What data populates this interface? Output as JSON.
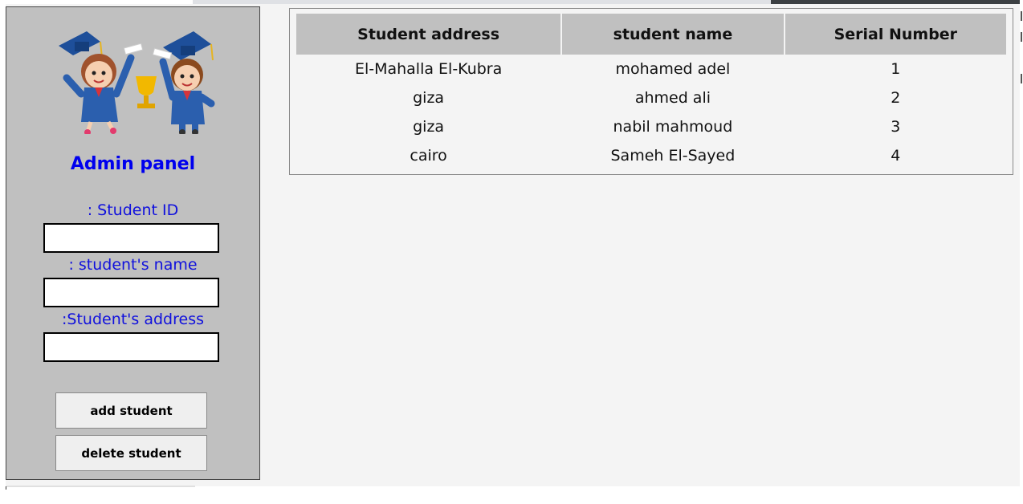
{
  "sidebar": {
    "logo_alt": "graduation",
    "title": "Admin panel",
    "fields": [
      {
        "label": ": Student ID",
        "value": ""
      },
      {
        "label": ": student's name",
        "value": ""
      },
      {
        "label": ":Student's address",
        "value": ""
      }
    ],
    "buttons": {
      "add": "add student",
      "delete": "delete student"
    }
  },
  "table": {
    "headers": [
      "Student address",
      "student name",
      "Serial Number"
    ],
    "rows": [
      [
        "El-Mahalla El-Kubra",
        "mohamed adel",
        "1"
      ],
      [
        "giza",
        "ahmed ali",
        "2"
      ],
      [
        "giza",
        "nabil mahmoud",
        "3"
      ],
      [
        "cairo",
        "Sameh El-Sayed",
        "4"
      ]
    ]
  },
  "colors": {
    "accent_text": "#0000ee",
    "sidebar_bg": "#c0c0c0",
    "header_bg": "#c0c0c0",
    "page_bg": "#f4f4f4"
  }
}
